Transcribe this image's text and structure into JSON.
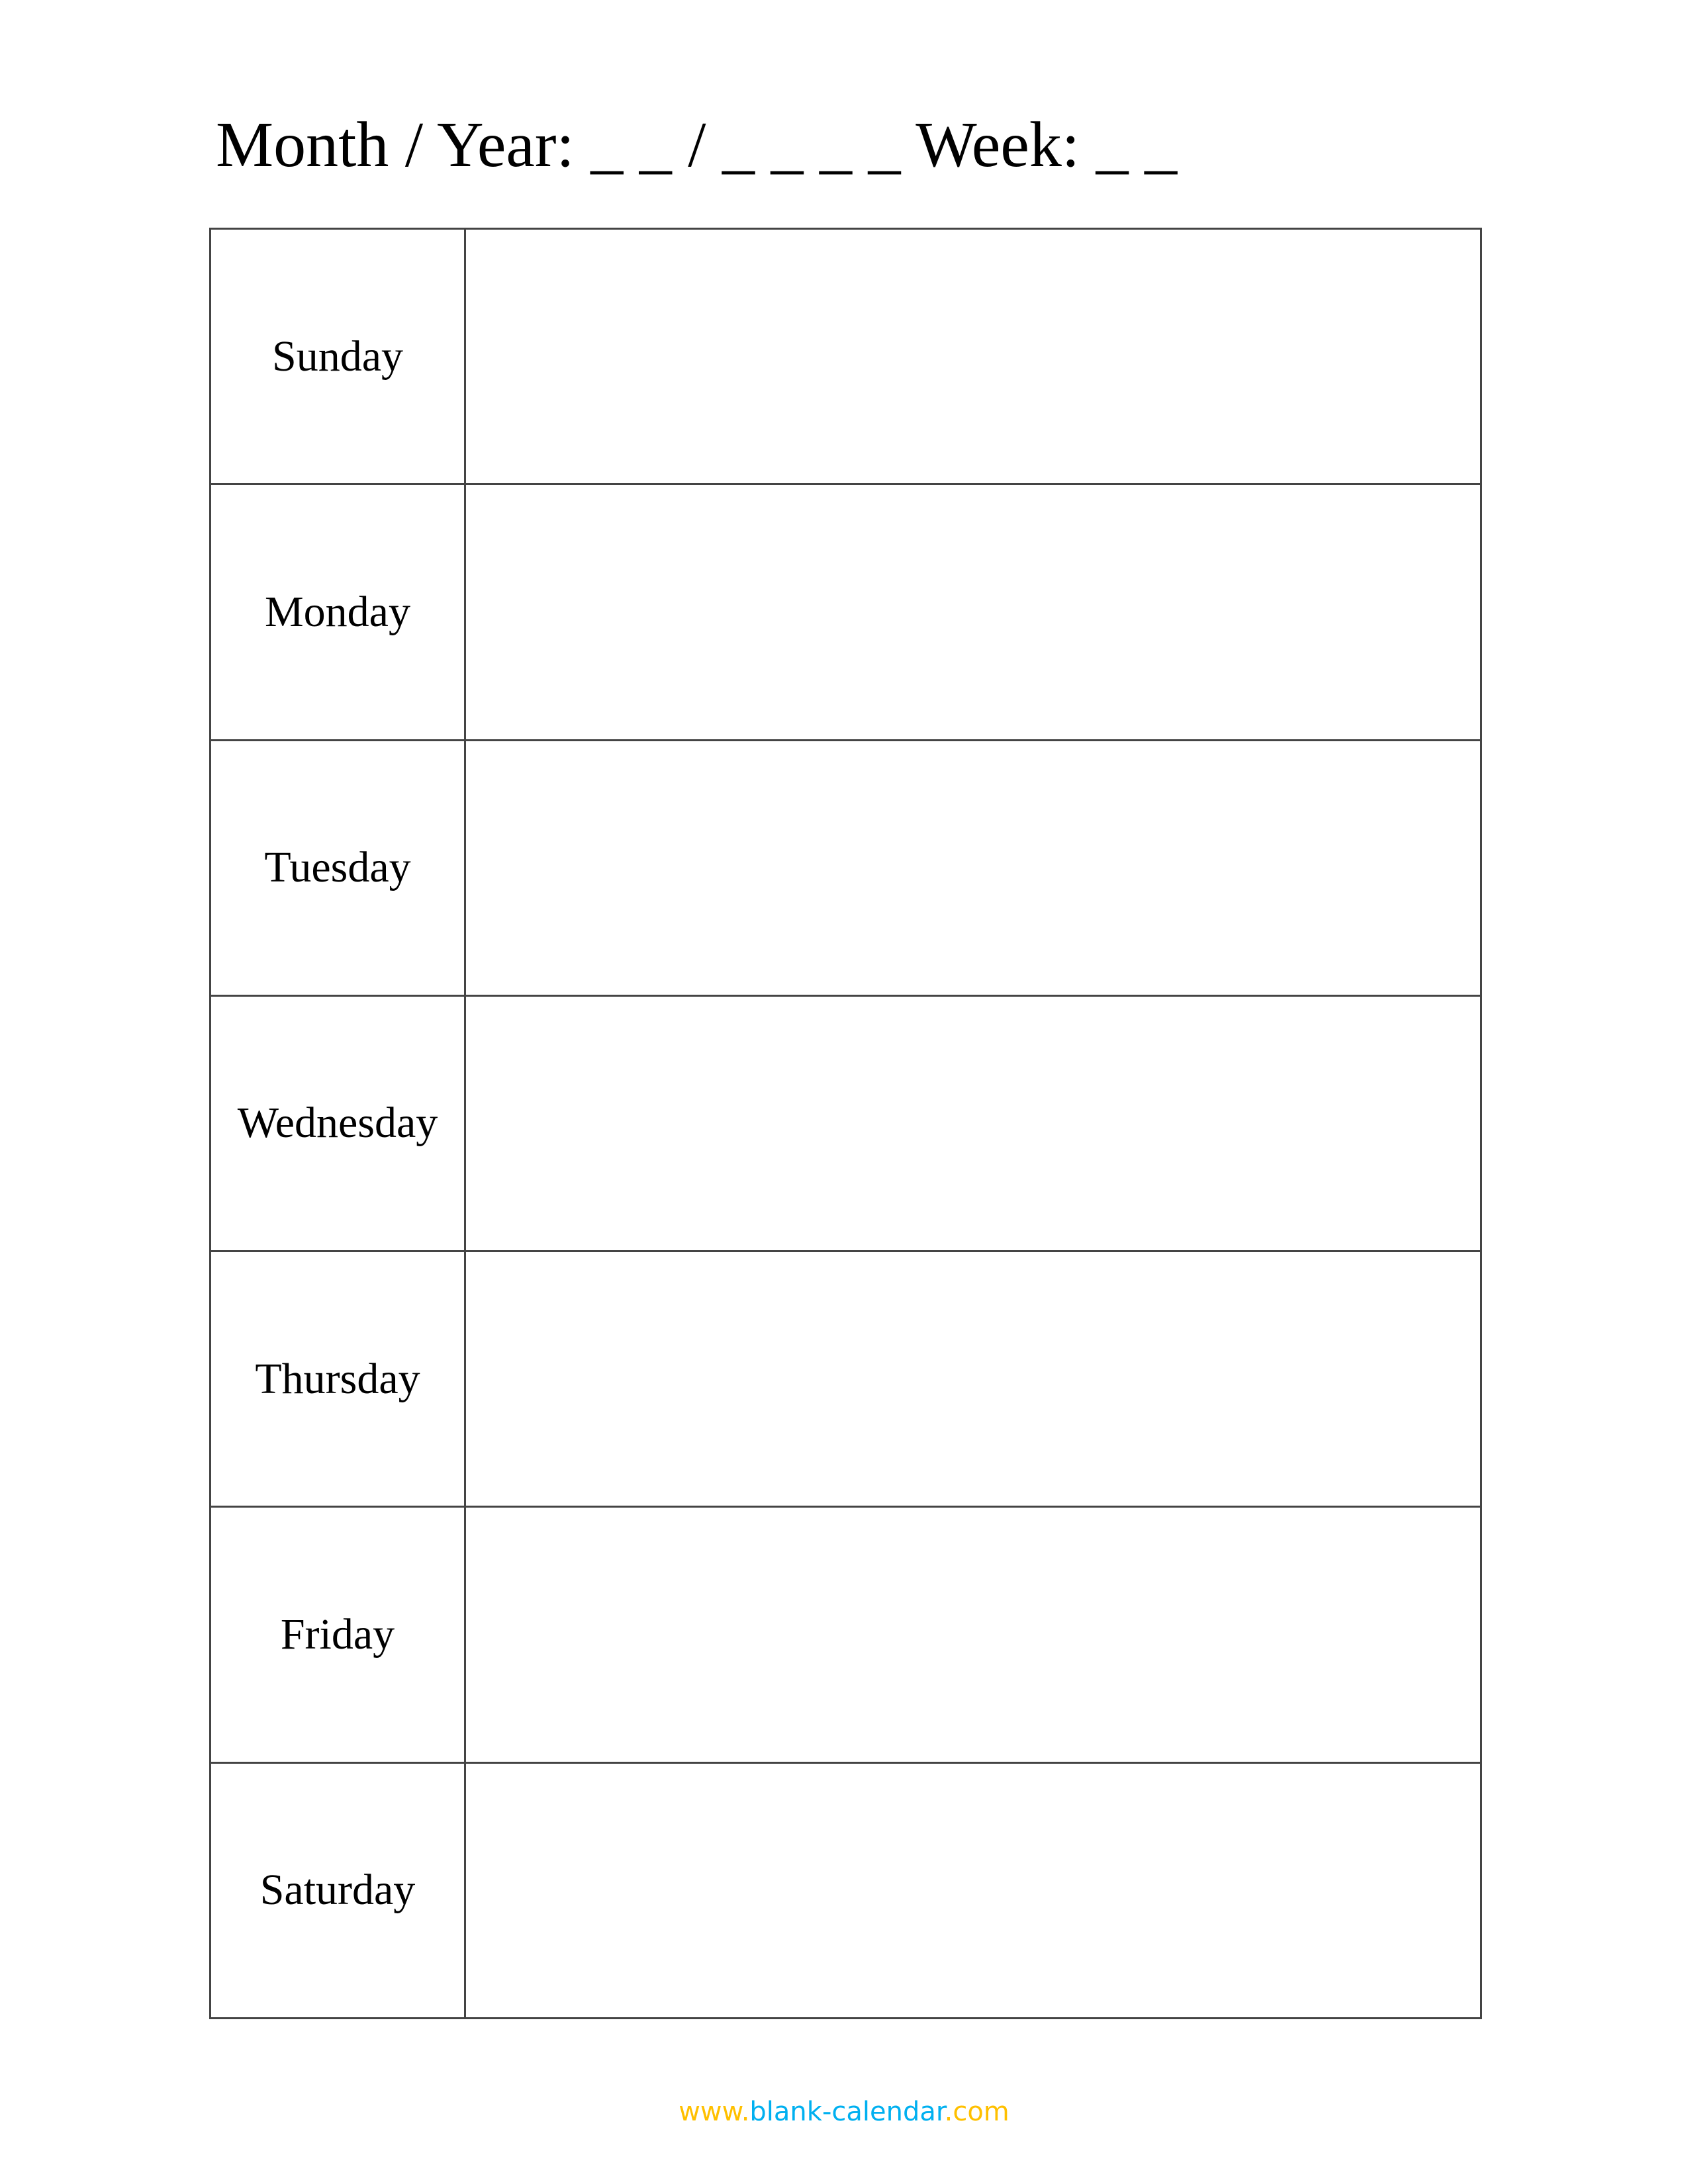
{
  "header": {
    "title": "Month / Year: _ _ / _ _ _ _ Week: _ _"
  },
  "days": [
    {
      "label": "Sunday"
    },
    {
      "label": "Monday"
    },
    {
      "label": "Tuesday"
    },
    {
      "label": "Wednesday"
    },
    {
      "label": "Thursday"
    },
    {
      "label": "Friday"
    },
    {
      "label": "Saturday"
    }
  ],
  "footer": {
    "prefix": "www.",
    "domain": "blank-calendar",
    "suffix": ".com"
  },
  "colors": {
    "accent_yellow": "#FFC000",
    "accent_blue": "#00B0F0",
    "border": "#444444"
  }
}
